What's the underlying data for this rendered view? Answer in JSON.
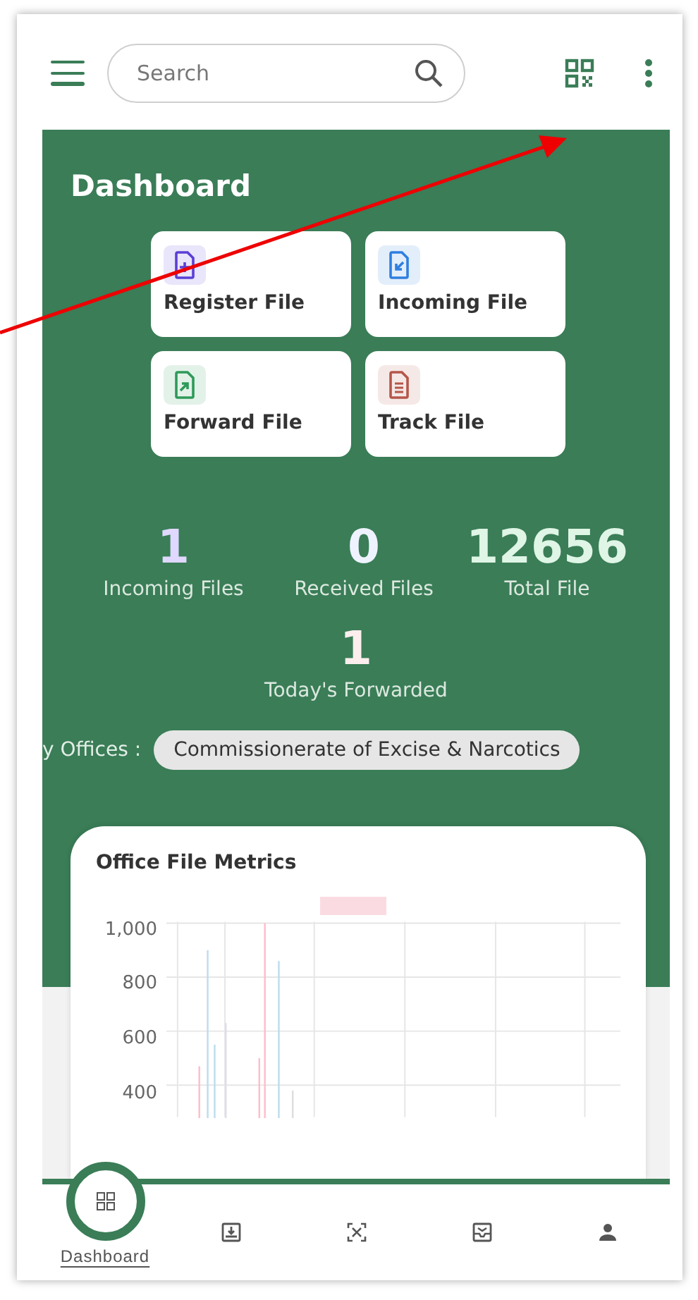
{
  "header": {
    "search": {
      "placeholder": "Search"
    }
  },
  "dashboard": {
    "title": "Dashboard",
    "actions": [
      {
        "label": "Register File",
        "kind": "register",
        "color": "#5b3fd6"
      },
      {
        "label": "Incoming File",
        "kind": "incoming",
        "color": "#2f7fe0"
      },
      {
        "label": "Forward File",
        "kind": "forward",
        "color": "#2e9a5a"
      },
      {
        "label": "Track File",
        "kind": "track",
        "color": "#b5574a"
      }
    ],
    "stats": [
      {
        "value": "1",
        "label": "Incoming Files"
      },
      {
        "value": "0",
        "label": "Received Files"
      },
      {
        "value": "12656",
        "label": "Total File"
      }
    ],
    "forwarded": {
      "value": "1",
      "label": "Today's Forwarded"
    },
    "offices": {
      "label": "y Offices :",
      "value": "Commissionerate of Excise & Narcotics"
    }
  },
  "chart_card": {
    "title": "Office File Metrics",
    "y_tick_labels": [
      "1,000",
      "800",
      "600",
      "400"
    ]
  },
  "bottom_nav": [
    {
      "kind": "dashboard",
      "label": "Dashboard",
      "selected": true
    },
    {
      "kind": "download",
      "selected": false
    },
    {
      "kind": "scan",
      "selected": false
    },
    {
      "kind": "inbox",
      "selected": false
    },
    {
      "kind": "profile",
      "selected": false
    }
  ]
}
